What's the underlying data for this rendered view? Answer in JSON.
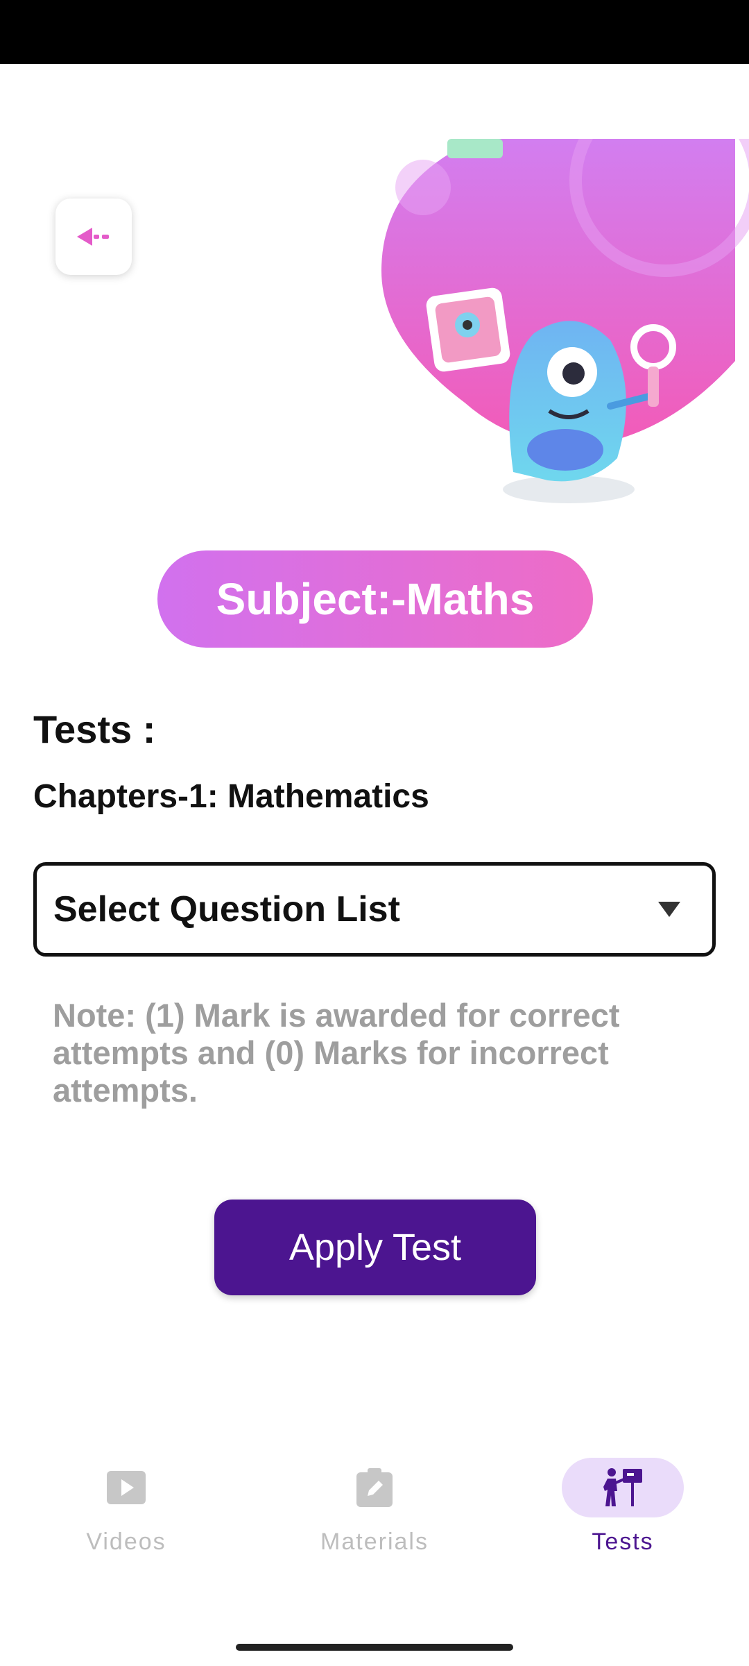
{
  "header": {
    "back_icon": "back-arrow-icon"
  },
  "subject": {
    "label": "Subject:-Maths"
  },
  "tests": {
    "heading": "Tests :",
    "chapter": "Chapters-1: Mathematics"
  },
  "question_select": {
    "selected": "Select Question List",
    "icon": "dropdown-caret-icon"
  },
  "note": "Note: (1) Mark is awarded for correct attempts and (0) Marks for incorrect attempts.",
  "apply_button": {
    "label": "Apply Test"
  },
  "bottom_nav": {
    "items": [
      {
        "label": "Videos",
        "icon": "video-play-icon",
        "active": false
      },
      {
        "label": "Materials",
        "icon": "edit-note-icon",
        "active": false
      },
      {
        "label": "Tests",
        "icon": "teacher-board-icon",
        "active": true
      }
    ]
  },
  "colors": {
    "accent": "#4c1590",
    "pill_gradient_start": "#d171ee",
    "pill_gradient_end": "#ee6cc6",
    "nav_active_bg": "#eadcfa",
    "nav_inactive": "#bdbdbd",
    "note_text": "#9e9e9e"
  }
}
